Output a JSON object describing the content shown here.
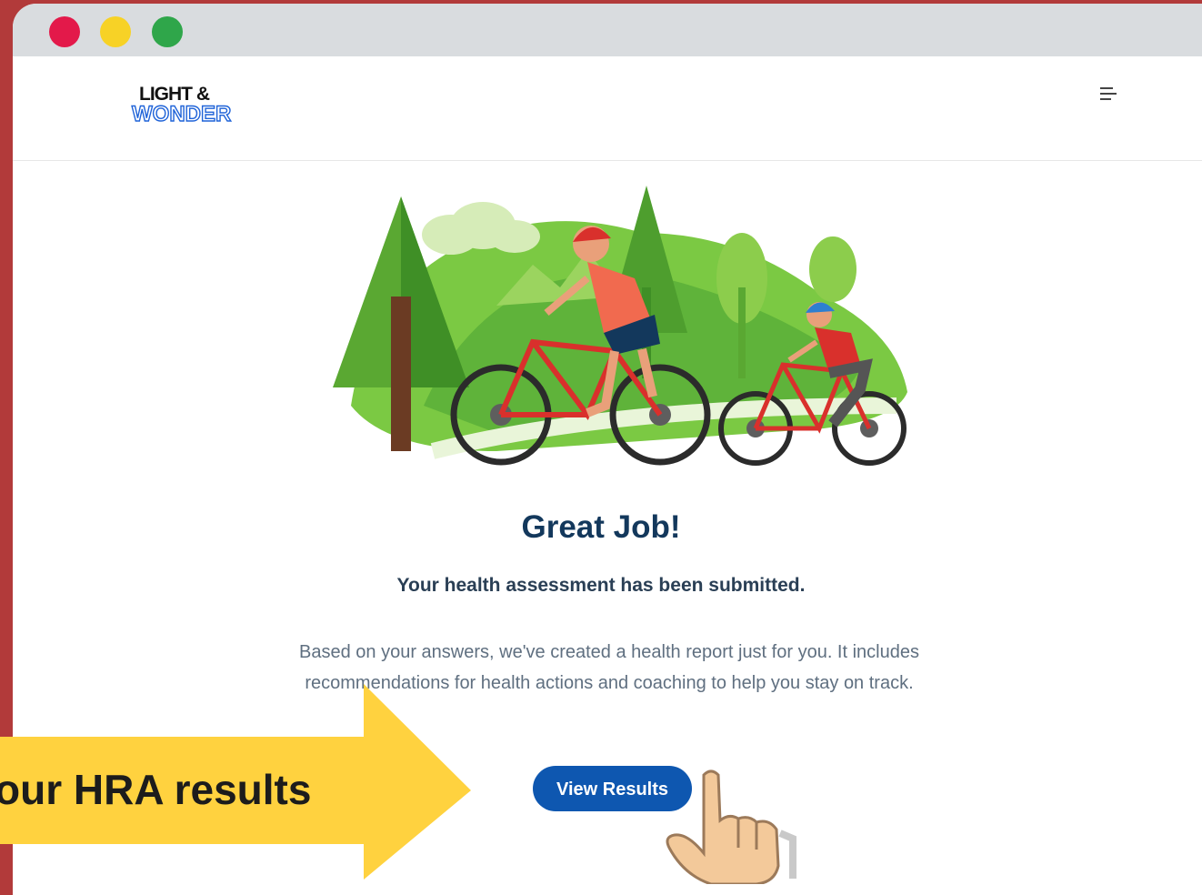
{
  "window": {
    "controls": [
      "close",
      "minimize",
      "maximize"
    ]
  },
  "header": {
    "logo_top": "LIGHT &",
    "logo_bottom": "WONDER",
    "menu_icon": "hamburger-menu-icon"
  },
  "illustration": {
    "subject": "mother-and-child-cycling-scene"
  },
  "content": {
    "title": "Great Job!",
    "subtitle": "Your health assessment has been submitted.",
    "body": "Based on your answers, we've created a health report just for you. It includes recommendations for health actions and coaching to help you stay on track.",
    "button_label": "View Results"
  },
  "overlay": {
    "arrow_label": "our HRA results"
  },
  "colors": {
    "background": "#b23a3a",
    "button": "#0e57b0",
    "title": "#13385c",
    "arrow": "#ffd23f"
  }
}
